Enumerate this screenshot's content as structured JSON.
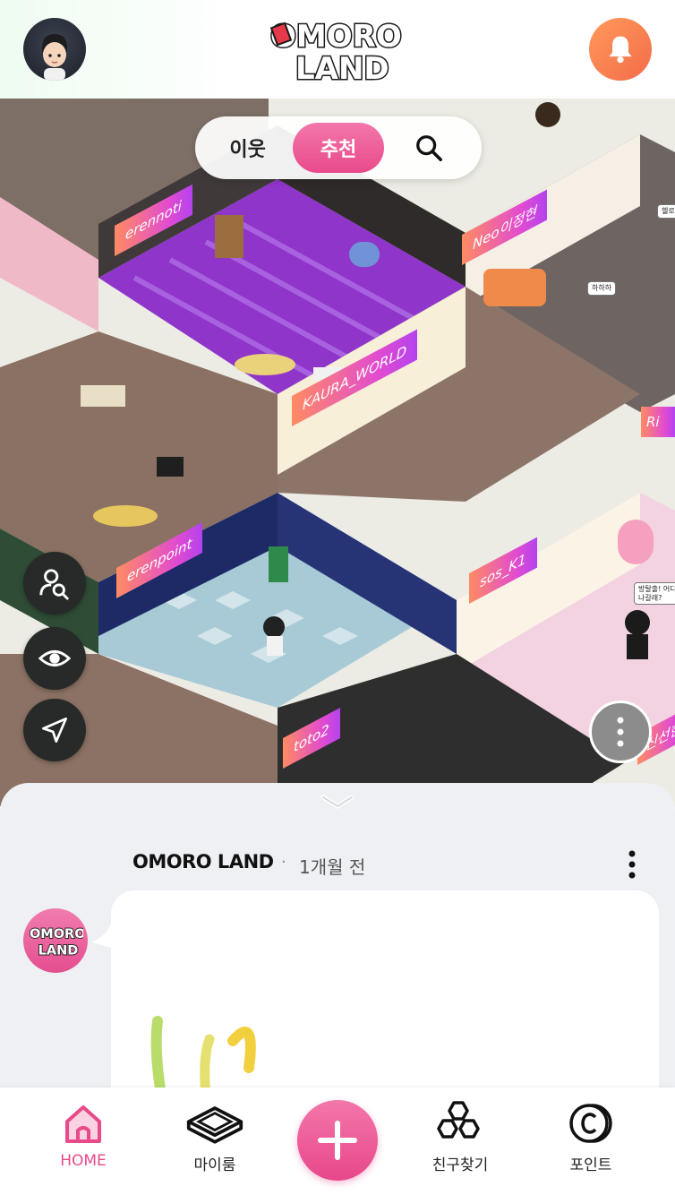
{
  "header": {
    "avatar_icon": "user-avatar",
    "logo_text": "OMORO LAND",
    "logo_line1": "OMORO",
    "logo_line2": "LAND",
    "bell_icon": "bell-icon",
    "bell_color": "#f4784c"
  },
  "tabs": [
    {
      "label": "이웃",
      "active": false
    },
    {
      "label": "추천",
      "active": true
    },
    {
      "label": "",
      "icon": "search-icon",
      "active": false
    }
  ],
  "rooms": [
    {
      "owner": "erennoti"
    },
    {
      "owner": "KAURA_WORLD"
    },
    {
      "owner": "Neo이정현"
    },
    {
      "owner": "erenpoint"
    },
    {
      "owner": "sos_K1"
    },
    {
      "owner": "toto2"
    },
    {
      "owner": "신선한"
    },
    {
      "owner": "Ri"
    }
  ],
  "speech": {
    "bubble_1": "헬로~",
    "bubble_2": "하하하",
    "bubble_3": "방탈출! 어디로\n나갈래?"
  },
  "floating_buttons": {
    "find_user_icon": "person-search-icon",
    "view_icon": "eye-icon",
    "navigate_icon": "navigation-arrow-icon",
    "more_icon": "more-vertical-icon"
  },
  "feed": {
    "author": "OMORO LAND",
    "separator": "·",
    "time": "1개월 전",
    "avatar_text_1": "OMORO",
    "avatar_text_2": "LAND"
  },
  "bottom_nav": [
    {
      "label": "HOME",
      "icon": "home-icon",
      "active": true
    },
    {
      "label": "마이룸",
      "icon": "room-icon",
      "active": false
    },
    {
      "label": "",
      "icon": "plus-icon",
      "active": false
    },
    {
      "label": "친구찾기",
      "icon": "hexagon-friends-icon",
      "active": false
    },
    {
      "label": "포인트",
      "icon": "point-coin-icon",
      "active": false
    }
  ],
  "colors": {
    "accent_pink": "#e84a8a",
    "tag_gradient_start": "#ff8b63",
    "tag_gradient_end": "#b442ee",
    "sheet_bg": "#eef0f4"
  }
}
